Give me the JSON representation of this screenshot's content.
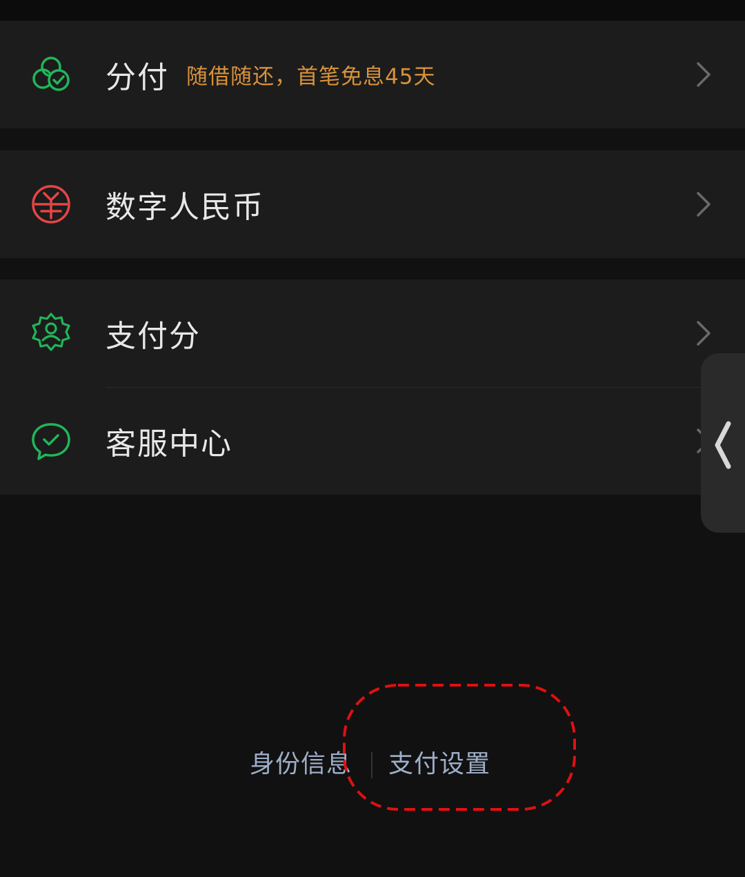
{
  "menu": {
    "fenfu": {
      "label": "分付",
      "promo": "随借随还，首笔免息45天",
      "icon": "fenfu-icon"
    },
    "digital_rmb": {
      "label": "数字人民币",
      "icon": "digital-rmb-icon"
    },
    "pay_score": {
      "label": "支付分",
      "icon": "pay-score-icon"
    },
    "customer_service": {
      "label": "客服中心",
      "icon": "customer-service-icon"
    }
  },
  "footer": {
    "identity_label": "身份信息",
    "settings_label": "支付设置"
  },
  "colors": {
    "background": "#111111",
    "card": "#1c1c1c",
    "green": "#20b65a",
    "red": "#e64545",
    "promo": "#d9923a",
    "footer_link": "#9eaec8",
    "annotation": "#e01010"
  }
}
